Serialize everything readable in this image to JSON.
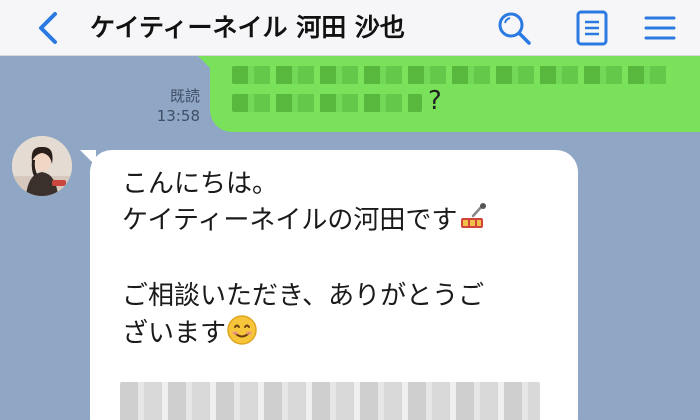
{
  "header": {
    "title": "ケイティーネイル 河田 沙也",
    "icons": [
      "chevron-left-icon",
      "search-icon",
      "notes-icon",
      "hamburger-menu-icon"
    ]
  },
  "sent_message": {
    "visible_suffix": "?",
    "read_status": "既読",
    "time": "13:58"
  },
  "received_message": {
    "lines": [
      "こんにちは。",
      "ケイティーネイルの河田です",
      "ご相談いただき、ありがとうご",
      "ざいます"
    ],
    "icons": [
      "nail-polish-icon",
      "smiling-face-emoji"
    ]
  },
  "colors": {
    "accent": "#2a7ae2",
    "chat_background": "#8fa6c4",
    "sent_bubble": "#79e25a",
    "received_bubble": "#ffffff"
  }
}
